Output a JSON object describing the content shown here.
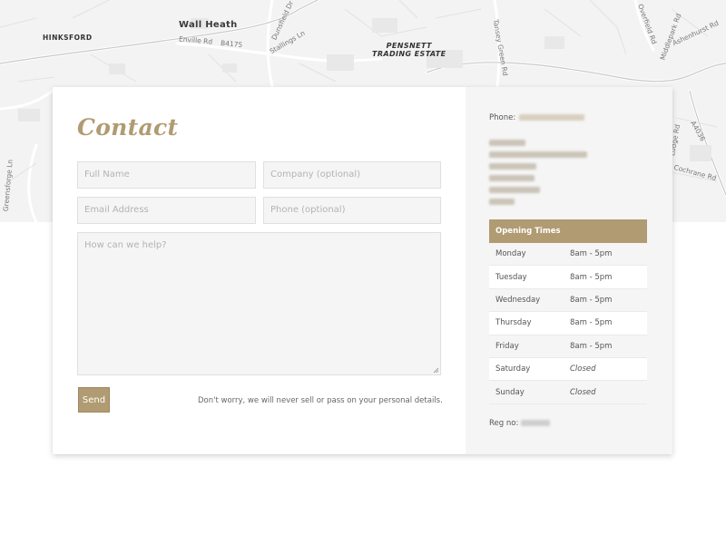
{
  "map": {
    "labels": {
      "wall_heath": "Wall Heath",
      "hinksford": "HINKSFORD",
      "pensnett_1": "PENSNETT",
      "pensnett_2": "TRADING ESTATE",
      "enville_rd": "Enville Rd",
      "b4175": "B4175",
      "stallings_ln": "Stallings Ln",
      "dunsfield_dr": "Dunsfield Dr",
      "tansey_green_rd": "Tansey Green Rd",
      "overfield_rd": "Overfield Rd",
      "middlepark_rd": "Middlepark Rd",
      "ashenhurst_rd": "Ashenhurst Rd",
      "a4036": "A4036",
      "greensforge_ln": "Greensforge Ln",
      "cochrane_rd": "Cochrane Rd",
      "lodge_rd": "Lodge Rd"
    }
  },
  "contact": {
    "title": "Contact",
    "fields": {
      "full_name": "Full Name",
      "company": "Company (optional)",
      "email": "Email Address",
      "phone": "Phone (optional)",
      "message": "How can we help?"
    },
    "send_label": "Send",
    "privacy_note": "Don't worry, we will never sell or pass on your personal details."
  },
  "sidebar": {
    "phone_label": "Phone:",
    "opening_times_title": "Opening Times",
    "hours": [
      {
        "day": "Monday",
        "time": "8am - 5pm"
      },
      {
        "day": "Tuesday",
        "time": "8am - 5pm"
      },
      {
        "day": "Wednesday",
        "time": "8am - 5pm"
      },
      {
        "day": "Thursday",
        "time": "8am - 5pm"
      },
      {
        "day": "Friday",
        "time": "8am - 5pm"
      },
      {
        "day": "Saturday",
        "time": "Closed"
      },
      {
        "day": "Sunday",
        "time": "Closed"
      }
    ],
    "reg_label": "Reg no:"
  },
  "colors": {
    "accent": "#b09b72",
    "map_background": "#f3f3f3",
    "panel_background": "#f5f5f5"
  }
}
